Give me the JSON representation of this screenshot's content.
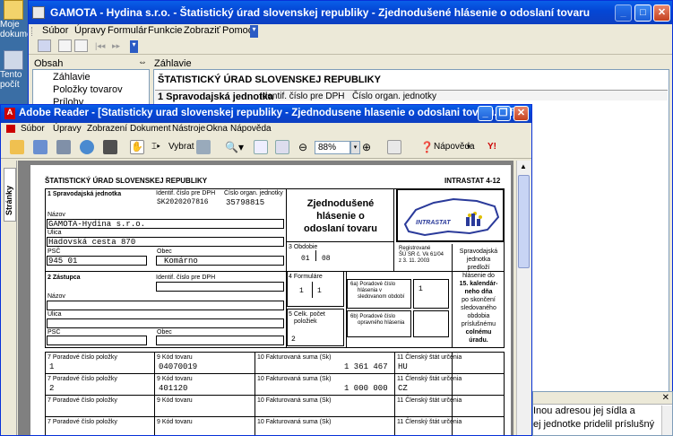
{
  "desktop": {
    "icons": [
      {
        "label": "Moje dokumenty"
      },
      {
        "label": "Tento počít"
      }
    ]
  },
  "back_window": {
    "title": "GAMOTA - Hydina s.r.o. - Štatistický úrad slovenskej republiky - Zjednodušené hlásenie o odoslaní tovaru",
    "menu": [
      "Súbor",
      "Úpravy",
      "Formulár",
      "Funkcie",
      "Zobraziť",
      "Pomoc"
    ],
    "left_panel_header": "Obsah",
    "right_panel_header": "Záhlavie",
    "tree": [
      "Záhlavie",
      "Položky tovarov",
      "Prílohy"
    ],
    "doc_title": "ŠTATISTICKÝ ÚRAD SLOVENSKEJ REPUBLIKY",
    "row_labels": [
      "1 Spravodajská jednotka",
      "Identif. číslo pre DPH",
      "Číslo organ. jednotky"
    ]
  },
  "adobe": {
    "title": "Adobe Reader - [Statisticky urad slovenskej republiky - Zjednodusene hlasenie o odoslani tovaru.pdf]",
    "menu": [
      "Súbor",
      "Úpravy",
      "Zobrazení",
      "Dokument",
      "Nástroje",
      "Okna",
      "Nápověda"
    ],
    "select_label": "Vybrat",
    "zoom": "88%",
    "help_label": "Nápověda",
    "side_tab": "Stránky"
  },
  "form": {
    "header": "ŠTATISTICKÝ ÚRAD SLOVENSKEJ REPUBLIKY",
    "form_code": "INTRASTAT 4-12",
    "title": [
      "Zjednodušené",
      "hlásenie o",
      "odoslaní tovaru"
    ],
    "logo_text": "INTRASTAT",
    "sec1_label": "1 Spravodajská jednotka",
    "dic_label": "Identif. číslo pre DPH",
    "dic_value": "SK2020207816",
    "org_label": "Číslo organ. jednotky",
    "org_value": "35798815",
    "name_label": "Názov",
    "name_value": "GAMOTA-Hydina s.r.o.",
    "street_label": "Ulica",
    "street_value": "Hadovská cesta 870",
    "psc_label": "PSČ",
    "psc_value": "945 01",
    "city_label": "Obec",
    "city_value": "Komárno",
    "period_label": "3 Obdobie",
    "period_month": "01",
    "period_year": "08",
    "reg_lines": [
      "Registrované",
      "ŠÚ SR č. Vk 61/04",
      "z 3. 11. 2003"
    ],
    "sec2_label": "2 Zástupca",
    "dic2_label": "Identif. číslo pre DPH",
    "forms_label": "4 Formuláre",
    "forms_a": "1",
    "forms_b": "1",
    "items_label": [
      "5 Celk. počet",
      "položiek"
    ],
    "items_value": "2",
    "seq_a_label": [
      "6a) Poradové číslo",
      "hlásenia v",
      "sledovanom období"
    ],
    "seq_a_value": "1",
    "seq_b_label": [
      "6b) Poradové číslo",
      "opravného hlásenia"
    ],
    "side_note": [
      "Spravodajská",
      "jednotka",
      "predloží",
      "hlásenie do",
      "15. kalendár-",
      "neho dňa",
      "po skončení",
      "sledovaného",
      "obdobia",
      "príslušnému",
      "colnému",
      "úradu."
    ],
    "col_labels": [
      "7 Poradové číslo položky",
      "9 Kód tovaru",
      "10 Fakturovaná suma (Sk)",
      "11 Členský štát určenia"
    ],
    "rows": [
      {
        "n": "1",
        "code": "04070019",
        "amount": "1 361 467",
        "state": "HU"
      },
      {
        "n": "2",
        "code": "401120",
        "amount": "1 000 000",
        "state": "CZ"
      }
    ]
  },
  "help_panel": {
    "lines": [
      "Inou adresou jej sídla a",
      "ej jednotke pridelil príslušný"
    ]
  },
  "colors": {
    "xp_blue": "#0447d6",
    "desktop": "#3a6ea5",
    "chrome": "#ece9d8"
  }
}
